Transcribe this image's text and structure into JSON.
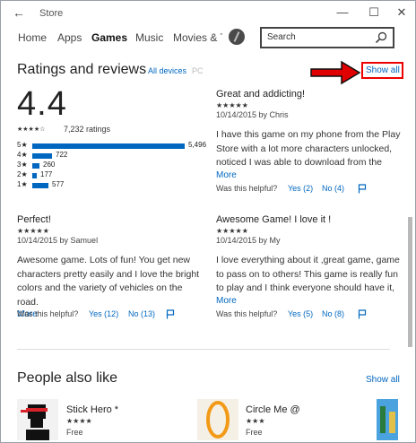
{
  "window": {
    "title": "Store",
    "back_glyph": "←",
    "minimize_glyph": "—",
    "maximize_glyph": "☐",
    "close_glyph": "✕"
  },
  "nav": {
    "items": [
      "Home",
      "Apps",
      "Games",
      "Music",
      "Movies & TV"
    ],
    "active": "Games",
    "search_placeholder": "Search"
  },
  "ratings": {
    "section_title": "Ratings and reviews",
    "filter_all_devices": "All devices",
    "filter_pc": "PC",
    "show_all": "Show all",
    "average": "4.4",
    "average_stars": "★★★★☆",
    "rating_count": "7,232 ratings",
    "distribution": [
      {
        "label": "5★",
        "count": "5,496",
        "fraction": 0.76
      },
      {
        "label": "4★",
        "count": "722",
        "fraction": 0.1
      },
      {
        "label": "3★",
        "count": "260",
        "fraction": 0.036
      },
      {
        "label": "2★",
        "count": "177",
        "fraction": 0.024
      },
      {
        "label": "1★",
        "count": "577",
        "fraction": 0.08
      }
    ]
  },
  "reviews": [
    {
      "title": "Great and addicting!",
      "stars": "★★★★★",
      "meta": "10/14/2015 by Chris",
      "body": "I have this game on my phone from the Play Store with a lot more characters unlocked, noticed I was able to download from the",
      "more": "More",
      "helpful_label": "Was this helpful?",
      "yes": "Yes (2)",
      "no": "No (4)"
    },
    {
      "title": "Perfect!",
      "stars": "★★★★★",
      "meta": "10/14/2015 by Samuel",
      "body": "Awesome game. Lots of fun! You get new characters pretty easily and I love the bright colors and the variety of vehicles on the road.",
      "more": "More",
      "helpful_label": "Was this helpful?",
      "yes": "Yes (12)",
      "no": "No (13)"
    },
    {
      "title": "Awesome Game! I love it !",
      "stars": "★★★★★",
      "meta": "10/14/2015 by My",
      "body": "I love everything about it ,great game, game to pass on to others! This game is really fun to play and I think everyone should have it,",
      "more": "More",
      "helpful_label": "Was this helpful?",
      "yes": "Yes (5)",
      "no": "No (8)"
    }
  ],
  "people_also_like": {
    "title": "People also like",
    "show_all": "Show all",
    "apps": [
      {
        "name": "Stick Hero *",
        "stars": "★★★★",
        "price": "Free"
      },
      {
        "name": "Circle Me @",
        "stars": "★★★",
        "price": "Free"
      }
    ]
  },
  "colors": {
    "accent": "#0067c0",
    "annotation_red": "#e00000"
  },
  "icons": {
    "search": "search-icon",
    "flag": "flag-icon",
    "arrow": "red-arrow-icon"
  }
}
